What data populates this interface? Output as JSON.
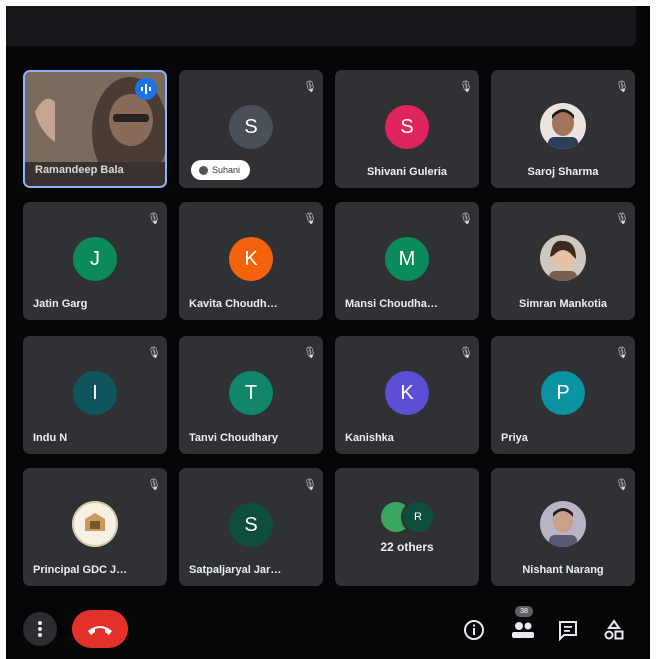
{
  "call": {
    "self_tile": {
      "name": "Ramandeep Bala"
    },
    "tiles": [
      {
        "name": "",
        "initial": "S",
        "color": "#4a5057",
        "chip": "Suhani"
      },
      {
        "name": "Shivani Guleria",
        "initial": "S",
        "color": "#e0245e"
      },
      {
        "name": "Saroj Sharma",
        "photo": true
      },
      {
        "name": "Jatin Garg",
        "initial": "J",
        "color": "#0b8a5c"
      },
      {
        "name": "Kavita Choudh…",
        "initial": "K",
        "color": "#f4620b"
      },
      {
        "name": "Mansi Choudha…",
        "initial": "M",
        "color": "#0b8a5c"
      },
      {
        "name": "Simran Mankotia",
        "photo": true
      },
      {
        "name": "Indu N",
        "initial": "I",
        "color": "#10545e"
      },
      {
        "name": "Tanvi Choudhary",
        "initial": "T",
        "color": "#12866a"
      },
      {
        "name": "Kanishka",
        "initial": "K",
        "color": "#5b4fd6"
      },
      {
        "name": "Priya",
        "initial": "P",
        "color": "#0b93a1"
      },
      {
        "name": "Principal GDC J…",
        "photo": true
      },
      {
        "name": "Satpaljaryal Jar…",
        "initial": "S",
        "color": "#0f4d3f"
      },
      {
        "name": "22 others",
        "others": true
      },
      {
        "name": "Nishant Narang",
        "photo": true
      }
    ],
    "others_initial": "R",
    "people_badge": "38"
  },
  "colors": {
    "end_call": "#e4322b",
    "self_border": "#8ab4f8",
    "tile_bg": "#2f3134",
    "bg": "#050607"
  },
  "icons": {
    "more": "more-vertical-icon",
    "end": "end-call-icon",
    "info": "info-icon",
    "people": "people-icon",
    "chat": "chat-icon",
    "activities": "activities-icon"
  }
}
